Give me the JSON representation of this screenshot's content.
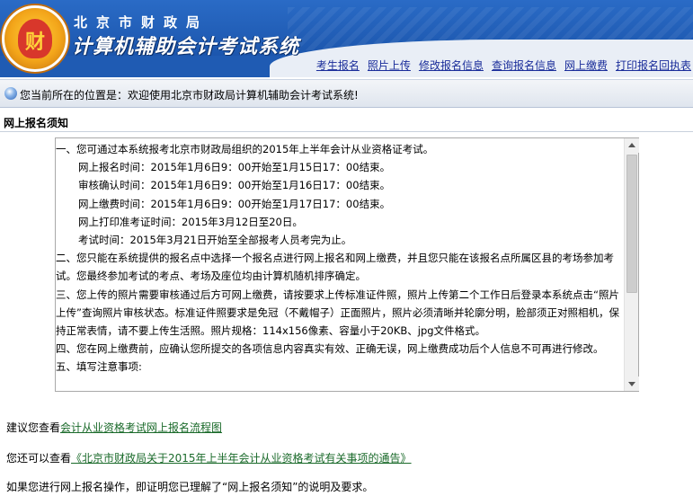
{
  "header": {
    "logo_glyph": "财",
    "org_name": "北京市财政局",
    "system_name": "计算机辅助会计考试系统"
  },
  "nav": [
    {
      "label": "考生报名"
    },
    {
      "label": "照片上传"
    },
    {
      "label": "修改报名信息"
    },
    {
      "label": "查询报名信息"
    },
    {
      "label": "网上缴费"
    },
    {
      "label": "打印报名回执表"
    }
  ],
  "location": {
    "text": "您当前所在的位置是：欢迎使用北京市财政局计算机辅助会计考试系统!"
  },
  "section_title": "网上报名须知",
  "notice": {
    "lines": [
      {
        "text": "一、您可通过本系统报考北京市财政局组织的2015年上半年会计从业资格证考试。",
        "indent": 0
      },
      {
        "text": "网上报名时间：2015年1月6日9：00开始至1月15日17：00结束。",
        "indent": 1
      },
      {
        "text": "审核确认时间：2015年1月6日9：00开始至1月16日17：00结束。",
        "indent": 1
      },
      {
        "text": "网上缴费时间：2015年1月6日9：00开始至1月17日17：00结束。",
        "indent": 1
      },
      {
        "text": "网上打印准考证时间：2015年3月12日至20日。",
        "indent": 1
      },
      {
        "text": "考试时间：2015年3月21日开始至全部报考人员考完为止。",
        "indent": 1
      },
      {
        "text": "二、您只能在系统提供的报名点中选择一个报名点进行网上报名和网上缴费，并且您只能在该报名点所属区县的考场参加考试。您最终参加考试的考点、考场及座位均由计算机随机排序确定。",
        "indent": 0
      },
      {
        "text": "三、您上传的照片需要审核通过后方可网上缴费，请按要求上传标准证件照，照片上传第二个工作日后登录本系统点击“照片上传”查询照片审核状态。标准证件照要求是免冠（不戴帽子）正面照片，照片必须清晰并轮廓分明，脸部须正对照相机，保持正常表情，请不要上传生活照。照片规格：114x156像素、容量小于20KB、jpg文件格式。",
        "indent": 0
      },
      {
        "text": "四、您在网上缴费前，应确认您所提交的各项信息内容真实有效、正确无误，网上缴费成功后个人信息不可再进行修改。",
        "indent": 0
      },
      {
        "text": "五、填写注意事项:",
        "indent": 0
      }
    ]
  },
  "links": {
    "flow_prefix": "建议您查看",
    "flow_link": "会计从业资格考试网上报名流程图",
    "notice_prefix": "您还可以查看",
    "notice_link": "《北京市财政局关于2015年上半年会计从业资格考试有关事项的通告》",
    "confirm_text": "如果您进行网上报名操作，即证明您已理解了“网上报名须知”的说明及要求。"
  }
}
